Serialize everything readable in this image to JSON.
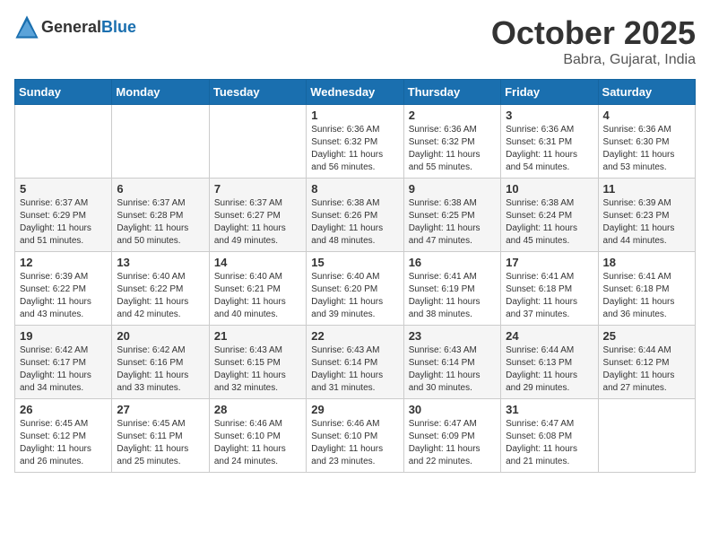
{
  "header": {
    "logo_general": "General",
    "logo_blue": "Blue",
    "month": "October 2025",
    "location": "Babra, Gujarat, India"
  },
  "weekdays": [
    "Sunday",
    "Monday",
    "Tuesday",
    "Wednesday",
    "Thursday",
    "Friday",
    "Saturday"
  ],
  "weeks": [
    [
      {
        "day": "",
        "info": ""
      },
      {
        "day": "",
        "info": ""
      },
      {
        "day": "",
        "info": ""
      },
      {
        "day": "1",
        "info": "Sunrise: 6:36 AM\nSunset: 6:32 PM\nDaylight: 11 hours and 56 minutes."
      },
      {
        "day": "2",
        "info": "Sunrise: 6:36 AM\nSunset: 6:32 PM\nDaylight: 11 hours and 55 minutes."
      },
      {
        "day": "3",
        "info": "Sunrise: 6:36 AM\nSunset: 6:31 PM\nDaylight: 11 hours and 54 minutes."
      },
      {
        "day": "4",
        "info": "Sunrise: 6:36 AM\nSunset: 6:30 PM\nDaylight: 11 hours and 53 minutes."
      }
    ],
    [
      {
        "day": "5",
        "info": "Sunrise: 6:37 AM\nSunset: 6:29 PM\nDaylight: 11 hours and 51 minutes."
      },
      {
        "day": "6",
        "info": "Sunrise: 6:37 AM\nSunset: 6:28 PM\nDaylight: 11 hours and 50 minutes."
      },
      {
        "day": "7",
        "info": "Sunrise: 6:37 AM\nSunset: 6:27 PM\nDaylight: 11 hours and 49 minutes."
      },
      {
        "day": "8",
        "info": "Sunrise: 6:38 AM\nSunset: 6:26 PM\nDaylight: 11 hours and 48 minutes."
      },
      {
        "day": "9",
        "info": "Sunrise: 6:38 AM\nSunset: 6:25 PM\nDaylight: 11 hours and 47 minutes."
      },
      {
        "day": "10",
        "info": "Sunrise: 6:38 AM\nSunset: 6:24 PM\nDaylight: 11 hours and 45 minutes."
      },
      {
        "day": "11",
        "info": "Sunrise: 6:39 AM\nSunset: 6:23 PM\nDaylight: 11 hours and 44 minutes."
      }
    ],
    [
      {
        "day": "12",
        "info": "Sunrise: 6:39 AM\nSunset: 6:22 PM\nDaylight: 11 hours and 43 minutes."
      },
      {
        "day": "13",
        "info": "Sunrise: 6:40 AM\nSunset: 6:22 PM\nDaylight: 11 hours and 42 minutes."
      },
      {
        "day": "14",
        "info": "Sunrise: 6:40 AM\nSunset: 6:21 PM\nDaylight: 11 hours and 40 minutes."
      },
      {
        "day": "15",
        "info": "Sunrise: 6:40 AM\nSunset: 6:20 PM\nDaylight: 11 hours and 39 minutes."
      },
      {
        "day": "16",
        "info": "Sunrise: 6:41 AM\nSunset: 6:19 PM\nDaylight: 11 hours and 38 minutes."
      },
      {
        "day": "17",
        "info": "Sunrise: 6:41 AM\nSunset: 6:18 PM\nDaylight: 11 hours and 37 minutes."
      },
      {
        "day": "18",
        "info": "Sunrise: 6:41 AM\nSunset: 6:18 PM\nDaylight: 11 hours and 36 minutes."
      }
    ],
    [
      {
        "day": "19",
        "info": "Sunrise: 6:42 AM\nSunset: 6:17 PM\nDaylight: 11 hours and 34 minutes."
      },
      {
        "day": "20",
        "info": "Sunrise: 6:42 AM\nSunset: 6:16 PM\nDaylight: 11 hours and 33 minutes."
      },
      {
        "day": "21",
        "info": "Sunrise: 6:43 AM\nSunset: 6:15 PM\nDaylight: 11 hours and 32 minutes."
      },
      {
        "day": "22",
        "info": "Sunrise: 6:43 AM\nSunset: 6:14 PM\nDaylight: 11 hours and 31 minutes."
      },
      {
        "day": "23",
        "info": "Sunrise: 6:43 AM\nSunset: 6:14 PM\nDaylight: 11 hours and 30 minutes."
      },
      {
        "day": "24",
        "info": "Sunrise: 6:44 AM\nSunset: 6:13 PM\nDaylight: 11 hours and 29 minutes."
      },
      {
        "day": "25",
        "info": "Sunrise: 6:44 AM\nSunset: 6:12 PM\nDaylight: 11 hours and 27 minutes."
      }
    ],
    [
      {
        "day": "26",
        "info": "Sunrise: 6:45 AM\nSunset: 6:12 PM\nDaylight: 11 hours and 26 minutes."
      },
      {
        "day": "27",
        "info": "Sunrise: 6:45 AM\nSunset: 6:11 PM\nDaylight: 11 hours and 25 minutes."
      },
      {
        "day": "28",
        "info": "Sunrise: 6:46 AM\nSunset: 6:10 PM\nDaylight: 11 hours and 24 minutes."
      },
      {
        "day": "29",
        "info": "Sunrise: 6:46 AM\nSunset: 6:10 PM\nDaylight: 11 hours and 23 minutes."
      },
      {
        "day": "30",
        "info": "Sunrise: 6:47 AM\nSunset: 6:09 PM\nDaylight: 11 hours and 22 minutes."
      },
      {
        "day": "31",
        "info": "Sunrise: 6:47 AM\nSunset: 6:08 PM\nDaylight: 11 hours and 21 minutes."
      },
      {
        "day": "",
        "info": ""
      }
    ]
  ]
}
